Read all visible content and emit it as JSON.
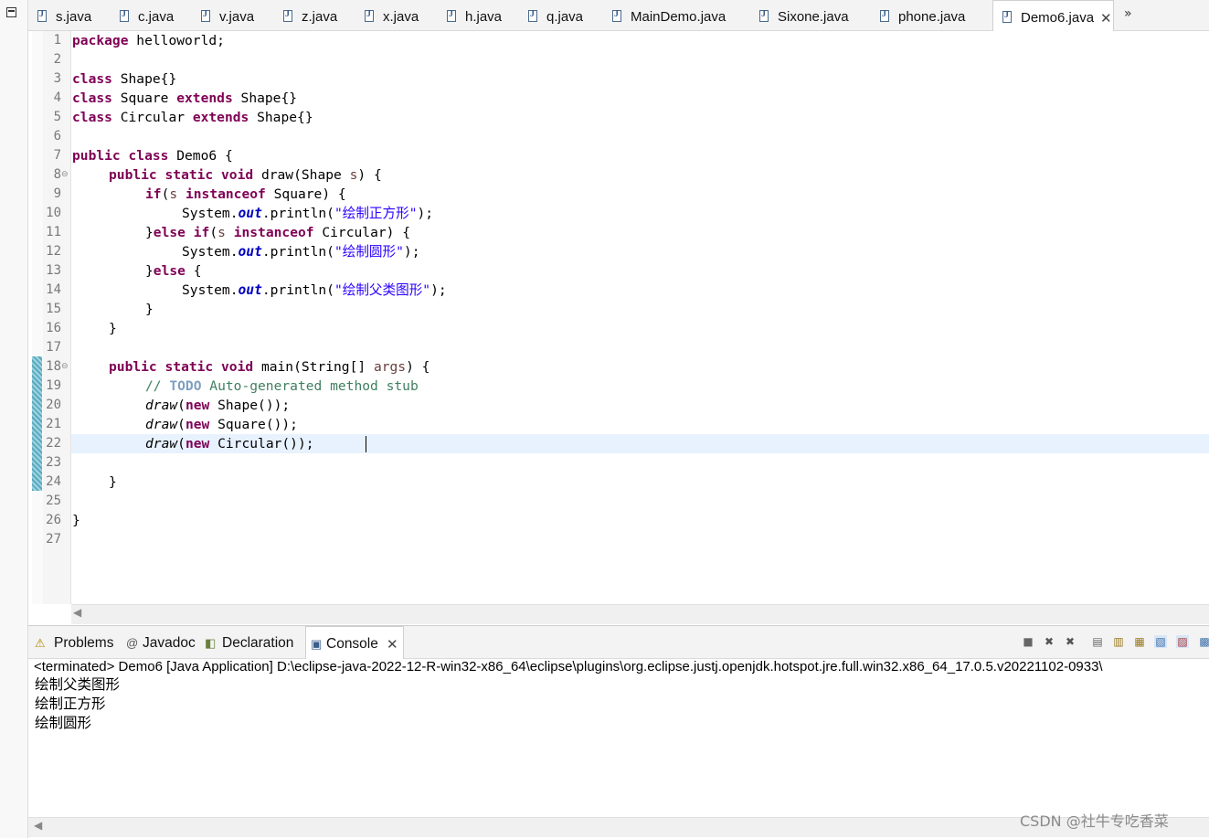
{
  "editor_tabs": [
    {
      "label": "s.java",
      "active": false
    },
    {
      "label": "c.java",
      "active": false
    },
    {
      "label": "v.java",
      "active": false
    },
    {
      "label": "z.java",
      "active": false
    },
    {
      "label": "x.java",
      "active": false
    },
    {
      "label": "h.java",
      "active": false
    },
    {
      "label": "q.java",
      "active": false
    },
    {
      "label": "MainDemo.java",
      "active": false
    },
    {
      "label": "Sixone.java",
      "active": false
    },
    {
      "label": "phone.java",
      "active": false
    },
    {
      "label": "Demo6.java",
      "active": true
    }
  ],
  "tab_close_glyph": "✕",
  "tab_overflow_glyph": "»",
  "line_numbers": [
    "1",
    "2",
    "3",
    "4",
    "5",
    "6",
    "7",
    "8",
    "9",
    "10",
    "11",
    "12",
    "13",
    "14",
    "15",
    "16",
    "17",
    "18",
    "19",
    "20",
    "21",
    "22",
    "23",
    "24",
    "25",
    "26",
    "27"
  ],
  "fold_marker": "⊖",
  "code": {
    "l1": {
      "kw": "package",
      "rest": " helloworld;"
    },
    "l3": {
      "kw": "class",
      "rest": " Shape{}"
    },
    "l4": {
      "kw1": "class",
      "mid": " Square ",
      "kw2": "extends",
      "rest": " Shape{}"
    },
    "l5": {
      "kw1": "class",
      "mid": " Circular ",
      "kw2": "extends",
      "rest": " Shape{}"
    },
    "l7": {
      "kw": "public class",
      "rest": " Demo6 {"
    },
    "l8": {
      "kw": "public static void",
      "mid": " draw(Shape ",
      "param": "s",
      "rest": ") {"
    },
    "l9": {
      "kw": "if",
      "open": "(",
      "param": "s",
      "sp": " ",
      "kw2": "instanceof",
      "rest": " Square) {"
    },
    "l10": {
      "a": "System.",
      "fld": "out",
      "b": ".println(",
      "str": "\"绘制正方形\"",
      "c": ");"
    },
    "l11": {
      "a": "}",
      "kw": "else if",
      "open": "(",
      "param": "s",
      "sp": " ",
      "kw2": "instanceof",
      "rest": " Circular) {"
    },
    "l12": {
      "a": "System.",
      "fld": "out",
      "b": ".println(",
      "str": "\"绘制圆形\"",
      "c": ");"
    },
    "l13": {
      "a": "}",
      "kw": "else",
      "rest": " {"
    },
    "l14": {
      "a": "System.",
      "fld": "out",
      "b": ".println(",
      "str": "\"绘制父类图形\"",
      "c": ");"
    },
    "l15": "}",
    "l16": "}",
    "l18": {
      "kw": "public static void",
      "mid": " main(String[] ",
      "param": "args",
      "rest": ") {"
    },
    "l19": {
      "cmt1": "// ",
      "todo": "TODO",
      "cmt2": " Auto-generated method stub"
    },
    "l20": {
      "mth": "draw",
      "open": "(",
      "kw": "new",
      "rest": " Shape());"
    },
    "l21": {
      "mth": "draw",
      "open": "(",
      "kw": "new",
      "rest": " Square());"
    },
    "l22": {
      "mth": "draw",
      "open": "(",
      "kw": "new",
      "rest": " Circular());"
    },
    "l24": "}",
    "l26": "}"
  },
  "console_tabs": [
    {
      "label": "Problems",
      "icon": "problems-icon",
      "glyph": "⚠",
      "active": false
    },
    {
      "label": "Javadoc",
      "icon": "javadoc-icon",
      "glyph": "@",
      "active": false
    },
    {
      "label": "Declaration",
      "icon": "declaration-icon",
      "glyph": "◧",
      "active": false
    },
    {
      "label": "Console",
      "icon": "console-icon",
      "glyph": "▣",
      "active": true
    }
  ],
  "console_toolbar": [
    "■",
    "✖",
    "✖",
    "▤",
    "▥",
    "▦",
    "▧",
    "▨",
    "▩"
  ],
  "console_status": "<terminated> Demo6 [Java Application] D:\\eclipse-java-2022-12-R-win32-x86_64\\eclipse\\plugins\\org.eclipse.justj.openjdk.hotspot.jre.full.win32.x86_64_17.0.5.v20221102-0933\\",
  "console_output": [
    "绘制父类图形",
    "绘制正方形",
    "绘制圆形"
  ],
  "watermark": "CSDN @社牛专吃香菜",
  "colors": {
    "keyword": "#7f0055",
    "string": "#2a00ff",
    "comment": "#3f7f5f",
    "field": "#0000c0",
    "current_line": "#e8f2fe"
  }
}
